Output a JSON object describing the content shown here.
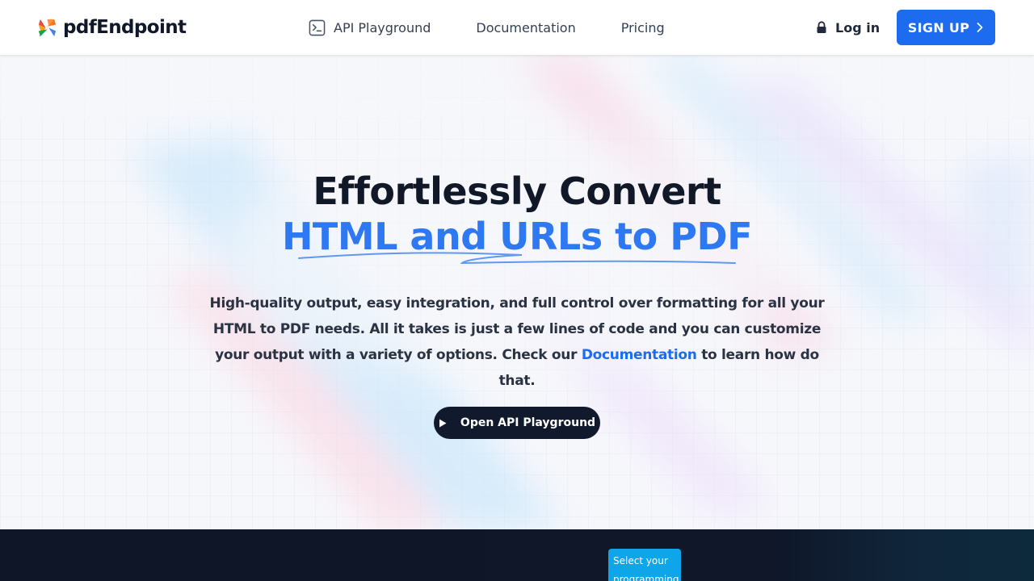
{
  "brand": {
    "name": "pdfEndpoint",
    "logo_icon": "pinwheel-logo-icon",
    "colors": {
      "red": "#ef4444",
      "orange": "#f59e0b",
      "green": "#22c55e",
      "blue": "#3b82f6"
    }
  },
  "nav": {
    "links": [
      {
        "label": "API Playground",
        "icon": "terminal-icon"
      },
      {
        "label": "Documentation"
      },
      {
        "label": "Pricing"
      }
    ],
    "login_label": "Log in",
    "login_icon": "lock-icon",
    "signup_label": "SIGN UP",
    "signup_icon": "chevron-right-icon"
  },
  "hero": {
    "title_line1": "Effortlessly Convert",
    "title_line2": "HTML and URLs to PDF",
    "description_part1": "High-quality output, easy integration, and full control over formatting for all your HTML to PDF needs. All it takes is just a few lines of code and you can customize your output with a variety of options. Check our ",
    "description_link": "Documentation",
    "description_part2": " to learn how do that.",
    "cta_label": "Open API Playground",
    "cta_icon": "play-icon"
  },
  "code_section": {
    "tooltip_text": "Select your programming"
  },
  "colors": {
    "accent": "#1d6cf0",
    "title_blue": "#2e78f2",
    "dark": "#111a2c",
    "tooltip": "#0ea5e9"
  }
}
